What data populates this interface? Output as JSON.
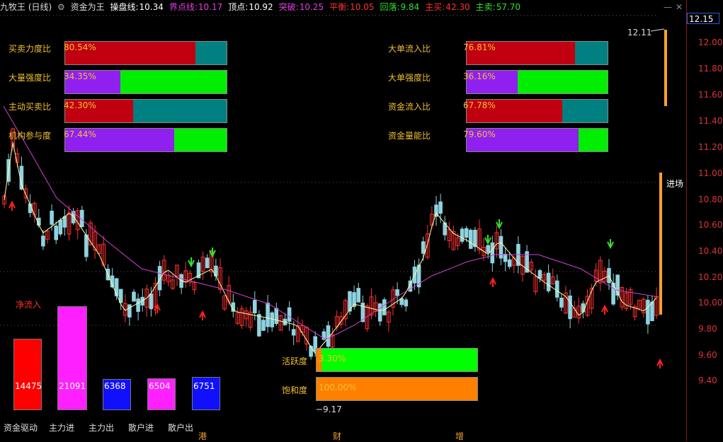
{
  "header": {
    "title": "九牧王 (日线)",
    "indicator": "资金为王",
    "items": [
      {
        "label": "操盘线:",
        "value": "10.34",
        "color": "#ffffff"
      },
      {
        "label": "界点线:",
        "value": "10.17",
        "color": "#e040e0"
      },
      {
        "label": "顶点:",
        "value": "10.92",
        "color": "#ffffff"
      },
      {
        "label": "突破:",
        "value": "10.25",
        "color": "#e040e0"
      },
      {
        "label": "平衡:",
        "value": "10.05",
        "color": "#ff3030"
      },
      {
        "label": "回落:",
        "value": "9.84",
        "color": "#30e030"
      },
      {
        "label": "主买:",
        "value": "42.30",
        "color": "#ff3030"
      },
      {
        "label": "主卖:",
        "value": "57.70",
        "color": "#30e030"
      }
    ]
  },
  "axis": {
    "current": "12.15",
    "ticks": [
      "12.00",
      "11.80",
      "11.60",
      "11.40",
      "11.20",
      "11.00",
      "10.80",
      "10.60",
      "10.40",
      "10.20",
      "10.00",
      "9.80",
      "9.60",
      "9.40"
    ]
  },
  "left_ratios": [
    {
      "label": "买卖力度比",
      "value": "80.54%",
      "pct": 80.54,
      "c1": "#c00010",
      "c2": "#008080"
    },
    {
      "label": "大量强度比",
      "value": "34.35%",
      "pct": 34.35,
      "c1": "#9020f0",
      "c2": "#00ee00"
    },
    {
      "label": "主动买卖比",
      "value": "42.30%",
      "pct": 42.3,
      "c1": "#c00010",
      "c2": "#008080"
    },
    {
      "label": "机构参与度",
      "value": "67.44%",
      "pct": 67.44,
      "c1": "#9020f0",
      "c2": "#00ee00"
    }
  ],
  "right_ratios": [
    {
      "label": "大单流入比",
      "value": "76.81%",
      "pct": 76.81,
      "c1": "#c00010",
      "c2": "#008080"
    },
    {
      "label": "大单强度比",
      "value": "36.16%",
      "pct": 36.16,
      "c1": "#9020f0",
      "c2": "#00ee00"
    },
    {
      "label": "资金流入比",
      "value": "67.78%",
      "pct": 67.78,
      "c1": "#c00010",
      "c2": "#008080"
    },
    {
      "label": "资金量能比",
      "value": "79.60%",
      "pct": 79.6,
      "c1": "#9020f0",
      "c2": "#00ee00"
    }
  ],
  "net_inflow_label": "净流入",
  "flow_bars": [
    {
      "label": "资金驱动",
      "value": "14475",
      "num": 14475,
      "color": "#ff0000"
    },
    {
      "label": "主力进",
      "value": "21091",
      "num": 21091,
      "color": "#ff20ff"
    },
    {
      "label": "主力出",
      "value": "6368",
      "num": 6368,
      "color": "#1010ff"
    },
    {
      "label": "散户进",
      "value": "6504",
      "num": 6504,
      "color": "#ff20ff"
    },
    {
      "label": "散户出",
      "value": "6751",
      "num": 6751,
      "color": "#1010ff"
    }
  ],
  "activity": [
    {
      "label": "活跃度",
      "value": "3.30%",
      "pct": 3.3,
      "c1": "#ff8000",
      "c2": "#00ff00"
    },
    {
      "label": "饱和度",
      "value": "100.00%",
      "pct": 100,
      "c1": "#ff8000",
      "c2": "#ff8000"
    }
  ],
  "annotations": {
    "high": "12.11",
    "low": "9.17",
    "entry": "进场"
  },
  "time_markers": [
    "港",
    "财",
    "增"
  ]
}
